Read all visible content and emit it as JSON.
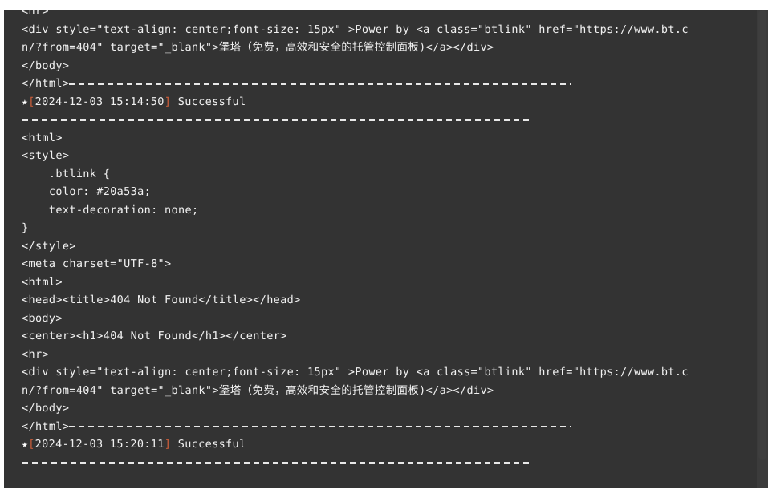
{
  "panel": {
    "kind": "log-console",
    "background_color": "#333333",
    "text_color": "#f1f1f1",
    "bracket_color": "#d4603a",
    "scrollbar_color": "#3e3e3e"
  },
  "log": {
    "lines": [
      {
        "type": "code",
        "text": "<hr>"
      },
      {
        "type": "code",
        "text": "<div style=\"text-align: center;font-size: 15px\" >Power by <a class=\"btlink\" href=\"https://www.bt.c"
      },
      {
        "type": "code",
        "text": "n/?from=404\" target=\"_blank\">堡塔（免费，高效和安全的托管控制面板)</a></div>"
      },
      {
        "type": "code",
        "text": "</body>"
      },
      {
        "type": "code-sep",
        "text": "</html>"
      },
      {
        "type": "status",
        "star": "★",
        "open_bracket": "[",
        "timestamp": "2024-12-03 15:14:50",
        "close_bracket": "]",
        "status": "Successful"
      },
      {
        "type": "sep"
      },
      {
        "type": "code",
        "text": "<html>"
      },
      {
        "type": "code",
        "text": "<style>"
      },
      {
        "type": "code",
        "text": "    .btlink {"
      },
      {
        "type": "code",
        "text": "    color: #20a53a;"
      },
      {
        "type": "code",
        "text": "    text-decoration: none;"
      },
      {
        "type": "code",
        "text": "}"
      },
      {
        "type": "code",
        "text": "</style>"
      },
      {
        "type": "code",
        "text": "<meta charset=\"UTF-8\">"
      },
      {
        "type": "code",
        "text": "<html>"
      },
      {
        "type": "code",
        "text": "<head><title>404 Not Found</title></head>"
      },
      {
        "type": "code",
        "text": "<body>"
      },
      {
        "type": "code",
        "text": "<center><h1>404 Not Found</h1></center>"
      },
      {
        "type": "code",
        "text": "<hr>"
      },
      {
        "type": "code",
        "text": "<div style=\"text-align: center;font-size: 15px\" >Power by <a class=\"btlink\" href=\"https://www.bt.c"
      },
      {
        "type": "code",
        "text": "n/?from=404\" target=\"_blank\">堡塔（免费，高效和安全的托管控制面板)</a></div>"
      },
      {
        "type": "code",
        "text": "</body>"
      },
      {
        "type": "code-sep",
        "text": "</html>"
      },
      {
        "type": "status",
        "star": "★",
        "open_bracket": "[",
        "timestamp": "2024-12-03 15:20:11",
        "close_bracket": "]",
        "status": "Successful"
      },
      {
        "type": "sep"
      }
    ]
  }
}
